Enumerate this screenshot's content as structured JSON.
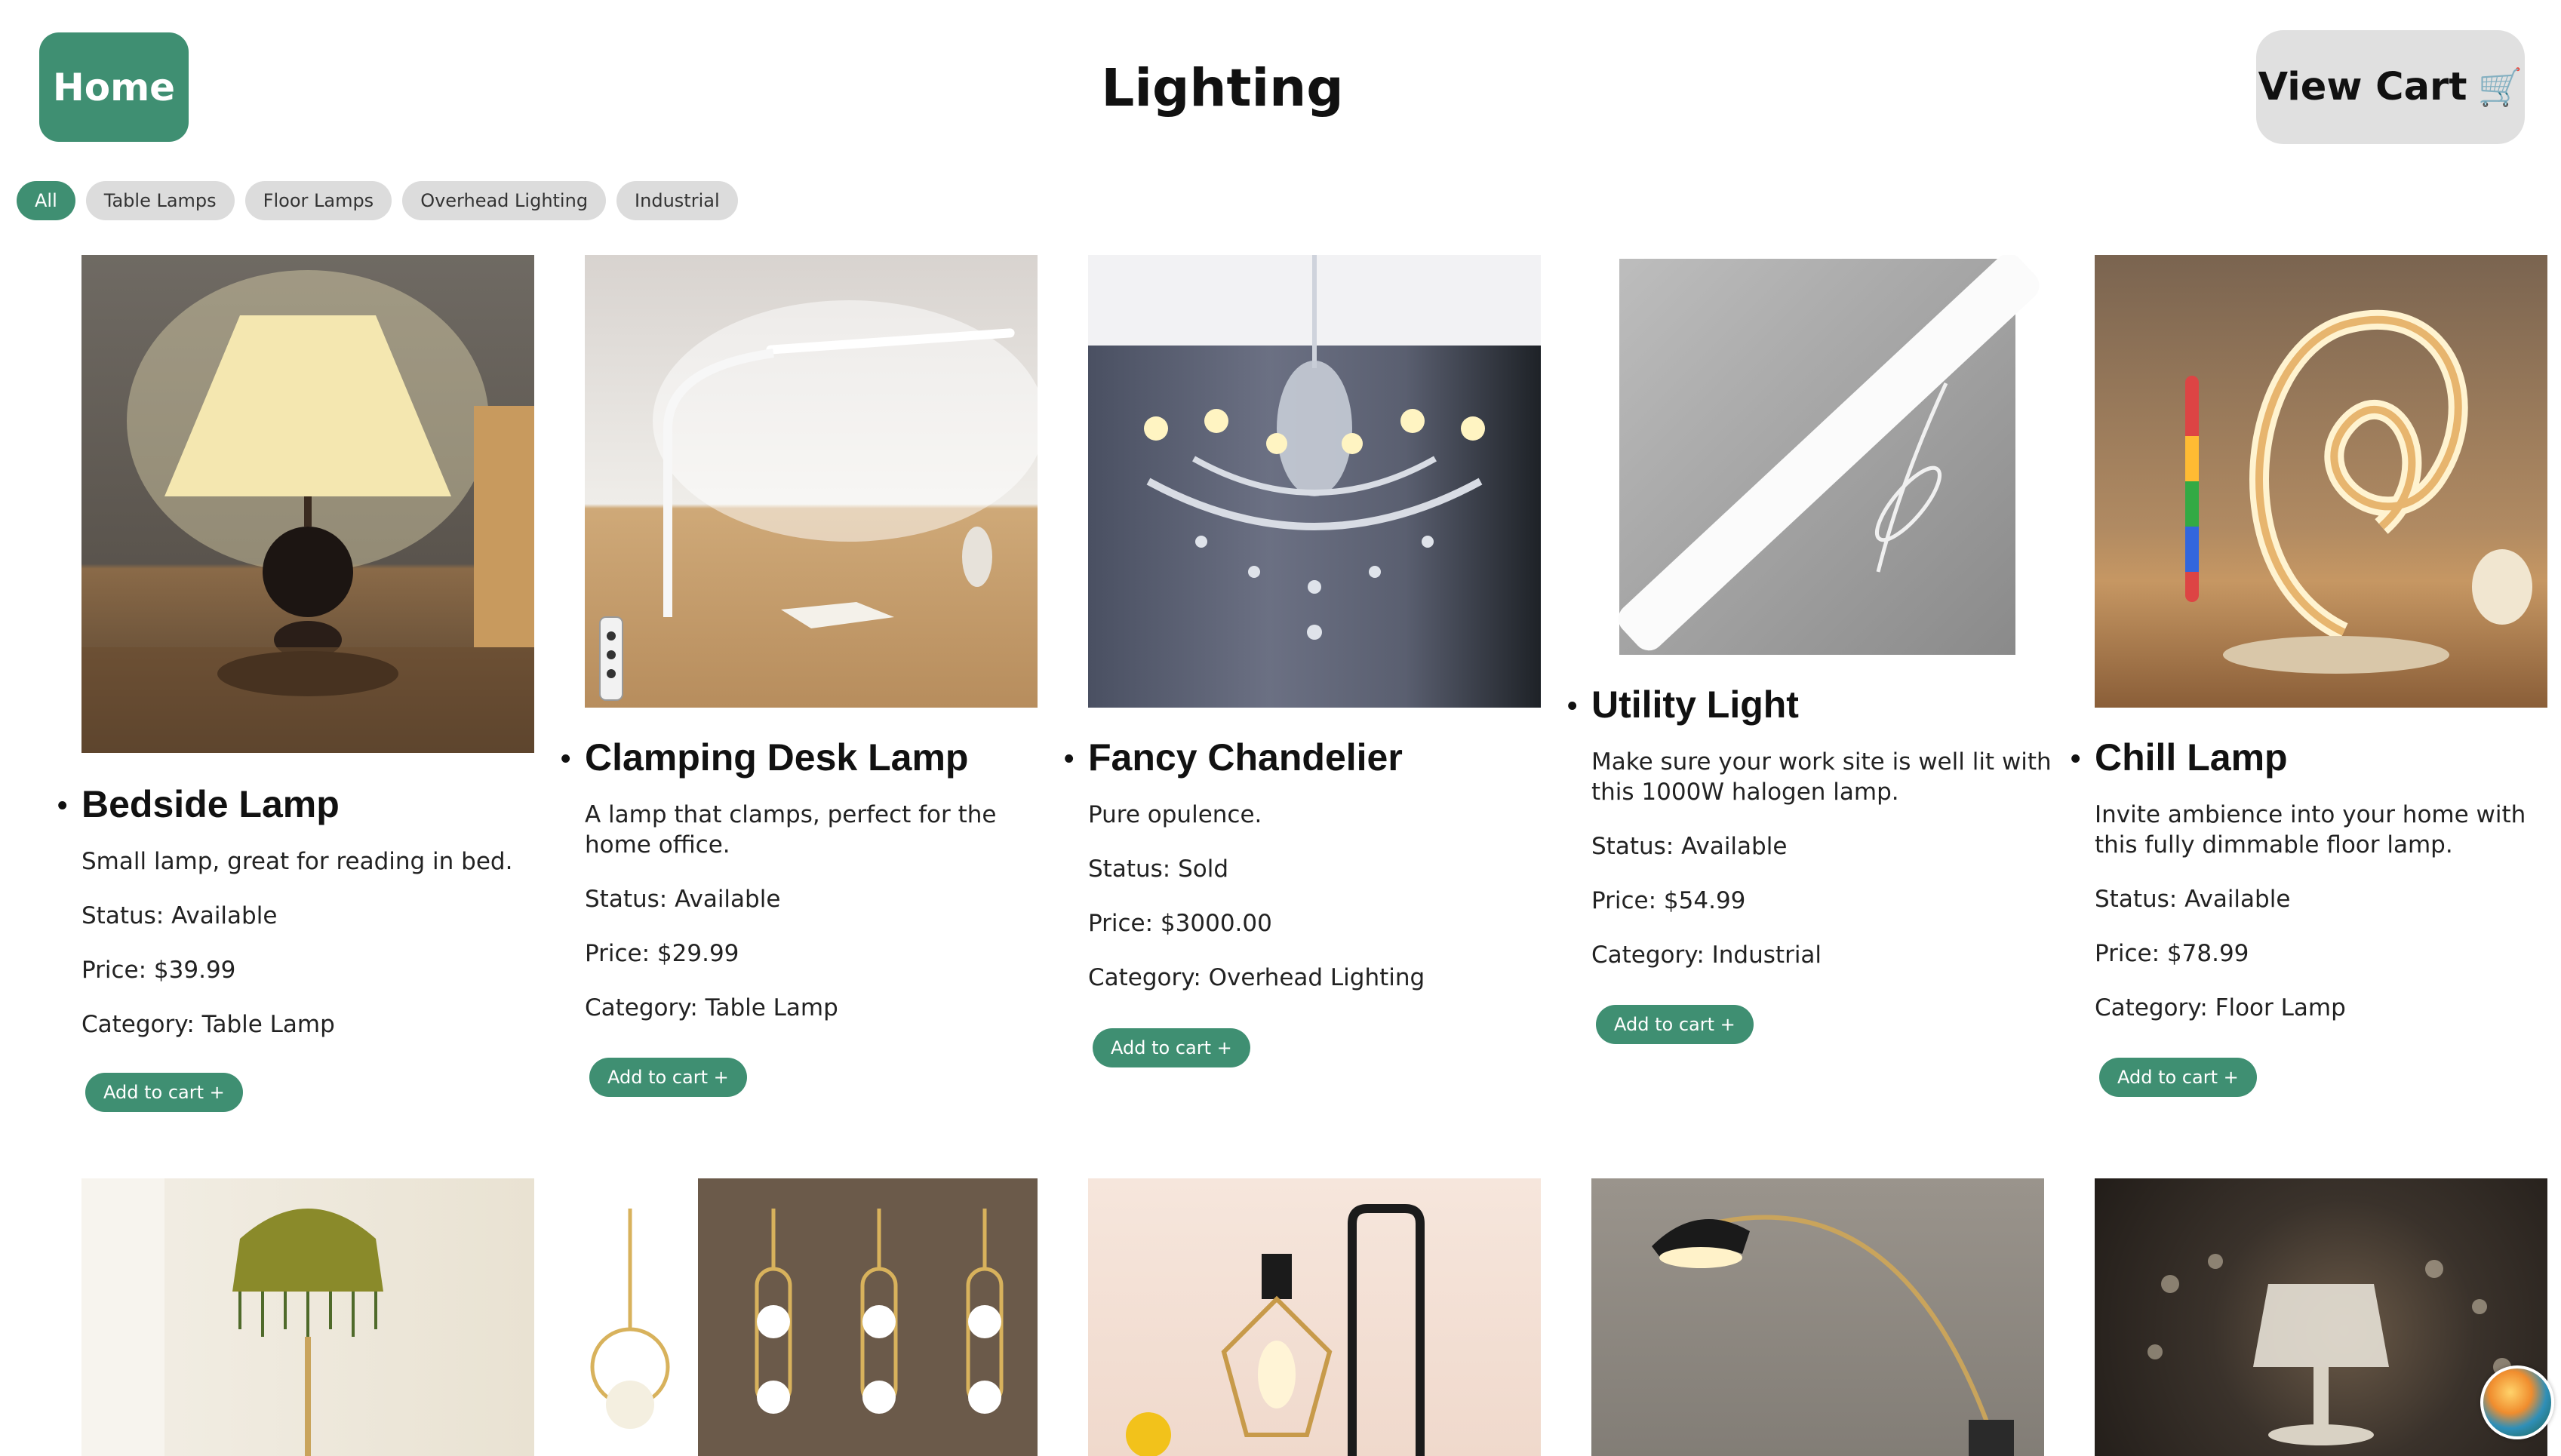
{
  "header": {
    "home_label": "Home",
    "title": "Lighting",
    "cart_label": "View Cart",
    "cart_icon": "🛒"
  },
  "filters": [
    "All",
    "Table Lamps",
    "Floor Lamps",
    "Overhead Lighting",
    "Industrial"
  ],
  "products": [
    {
      "name": "Bedside Lamp",
      "description": "Small lamp, great for reading in bed.",
      "status": "Status: Available",
      "price": "Price: $39.99",
      "category": "Category: Table Lamp",
      "add_label": "Add to cart +"
    },
    {
      "name": "Clamping Desk Lamp",
      "description": "A lamp that clamps, perfect for the home office.",
      "status": "Status: Available",
      "price": "Price: $29.99",
      "category": "Category: Table Lamp",
      "add_label": "Add to cart +"
    },
    {
      "name": "Fancy Chandelier",
      "description": "Pure opulence.",
      "status": "Status: Sold",
      "price": "Price: $3000.00",
      "category": "Category: Overhead Lighting",
      "add_label": "Add to cart +"
    },
    {
      "name": "Utility Light",
      "description": "Make sure your work site is well lit with this 1000W halogen lamp.",
      "status": "Status: Available",
      "price": "Price: $54.99",
      "category": "Category: Industrial",
      "add_label": "Add to cart +"
    },
    {
      "name": "Chill Lamp",
      "description": "Invite ambience into your home with this fully dimmable floor lamp.",
      "status": "Status: Available",
      "price": "Price: $78.99",
      "category": "Category: Floor Lamp",
      "add_label": "Add to cart +"
    }
  ],
  "second_row_images": [
    "fringe-floor-lamp-image",
    "pendant-lights-image",
    "cage-table-lamp-image",
    "arc-floor-lamp-image",
    "crystal-table-lamp-image"
  ]
}
